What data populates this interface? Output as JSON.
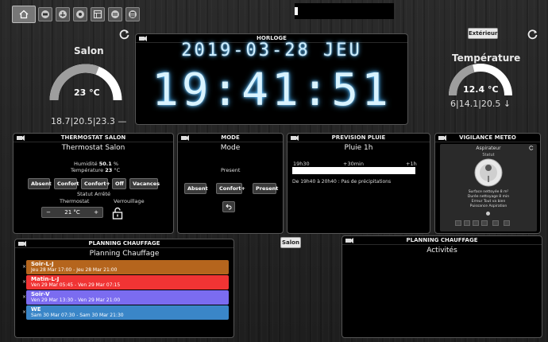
{
  "nav": {
    "items": [
      "home-icon",
      "camera-icon",
      "calendar-icon",
      "settings-icon",
      "grid-icon",
      "table-icon",
      "building-icon"
    ]
  },
  "salon_gauge": {
    "title": "Salon",
    "value": "23 °C",
    "sub": "18.7|20.5|23.3 —",
    "level": 0.62,
    "color": "#9e9e9e"
  },
  "temp_gauge": {
    "title": "Température",
    "value": "12.4 °C",
    "sub": "6|14.1|20.5 ↓",
    "level": 0.42,
    "color": "#9e9e9e"
  },
  "exterieur_button": "Extérieur",
  "horloge": {
    "header": "HORLOGE",
    "date": "2019-03-28 JEU",
    "time": "19:41:51"
  },
  "thermostat": {
    "header": "THERMOSTAT SALON",
    "title": "Thermostat Salon",
    "humidite_label": "Humidité",
    "humidite_value": "50.1",
    "humidite_unit": "%",
    "temperature_label": "Température",
    "temperature_value": "23",
    "temperature_unit": "°C",
    "buttons": [
      "Absent",
      "Confort",
      "Confort+",
      "Off",
      "Vacances"
    ],
    "statut_label": "Statut",
    "statut_value": "Arrêté",
    "thermostat_label": "Thermostat",
    "setpoint": "21 °C",
    "minus": "−",
    "plus": "+",
    "verrouillage_label": "Verrouillage"
  },
  "mode": {
    "header": "MODE",
    "title": "Mode",
    "current": "Present",
    "buttons": [
      "Absent",
      "Confort+",
      "Present"
    ]
  },
  "pluie": {
    "header": "PREVISION PLUIE",
    "title": "Pluie 1h",
    "t0": "19h30",
    "t1": "+30min",
    "t2": "+1h",
    "forecast": "De 19h40 à 20h40 : Pas de précipitations"
  },
  "vigilance": {
    "header": "VIGILANCE METEO",
    "device": "Aspirateur",
    "statut": "Statut",
    "lines": [
      "Surface nettoyée 8 m²",
      "Durée nettoyage 8 min",
      "Erreur Tout va bien",
      "Puissance Aspiration"
    ]
  },
  "planning_left": {
    "header": "PLANNING CHAUFFAGE",
    "title": "Planning Chauffage",
    "items": [
      {
        "title": "Soir-L-J",
        "detail": "Jeu 28 Mar 17:00 - Jeu 28 Mar 21:00",
        "color": "#b5651d"
      },
      {
        "title": "Matin-L-J",
        "detail": "Ven 29 Mar 05:45 - Ven 29 Mar 07:15",
        "color": "#f03434"
      },
      {
        "title": "Soir-V",
        "detail": "Ven 29 Mar 13:30 - Ven 29 Mar 21:00",
        "color": "#7b6cf0"
      },
      {
        "title": "WE",
        "detail": "Sam 30 Mar 07:30 - Sam 30 Mar 21:30",
        "color": "#3a86c8"
      }
    ],
    "close_glyph": "×"
  },
  "salon_button": "Salon",
  "planning_right": {
    "header": "PLANNING CHAUFFAGE",
    "title": "Activités"
  }
}
